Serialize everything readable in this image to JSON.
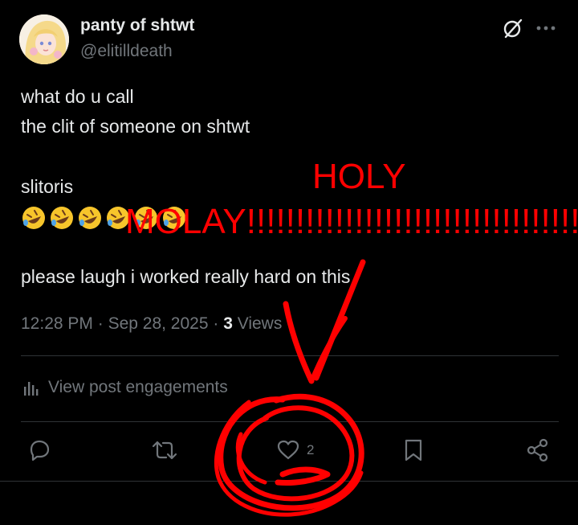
{
  "author": {
    "display_name": "panty of shtwt",
    "handle": "@elitilldeath"
  },
  "post": {
    "lines": [
      "what do u call",
      "the clit of someone on shtwt",
      "slitoris",
      "please laugh i worked really hard on this"
    ],
    "emojis": [
      "rolling-on-floor-laughing",
      "rolling-on-floor-laughing",
      "rolling-on-floor-laughing",
      "rolling-on-floor-laughing",
      "rolling-on-floor-laughing",
      "rolling-on-floor-laughing"
    ]
  },
  "meta": {
    "time": "12:28 PM",
    "separator": " · ",
    "date": "Sep 28, 2025",
    "views_count": "3",
    "views_label": " Views"
  },
  "engagements": {
    "label": "View post engagements"
  },
  "actions": {
    "like_count": "2"
  },
  "annotation": {
    "word1": "HOLY",
    "word2": "MOLAY!!!!!!!!!!!!!!!!!!!!!!!!!!!!!!!!!!!!",
    "color": "#ff0000"
  },
  "colors": {
    "background": "#000000",
    "text": "#e7e9ea",
    "muted": "#71767b",
    "divider": "#2f3336"
  }
}
